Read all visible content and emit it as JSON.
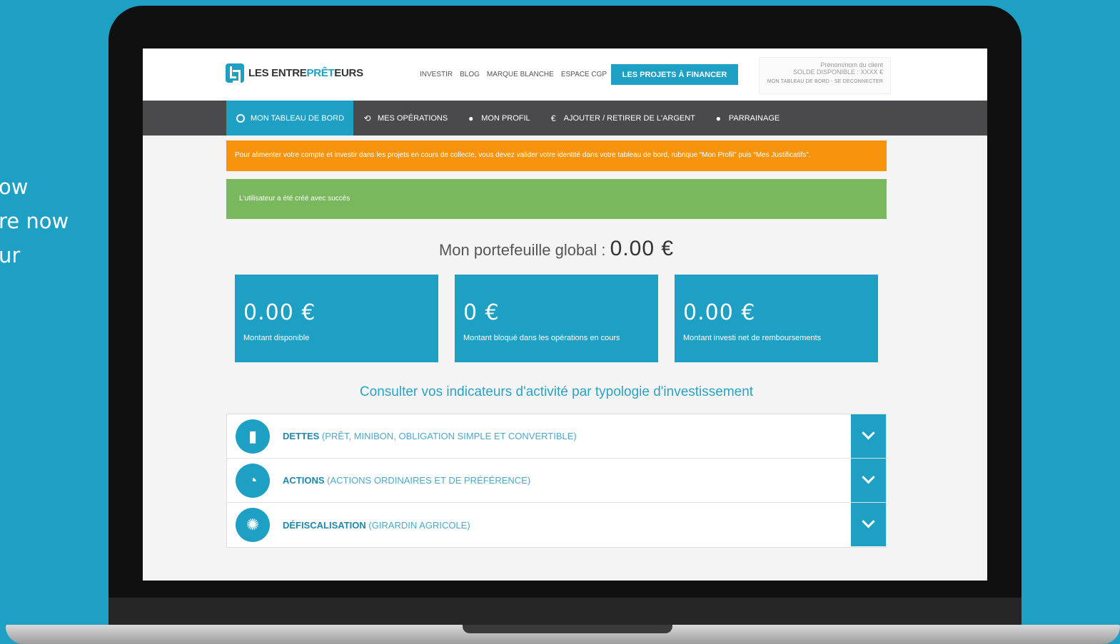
{
  "side_text": [
    "ow",
    "re now",
    "ur"
  ],
  "header": {
    "logo_prefix": "LES ENTRE",
    "logo_accent": "PRÊT",
    "logo_suffix": "EURS",
    "nav": [
      "INVESTIR",
      "BLOG",
      "MARQUE BLANCHE",
      "ESPACE CGP"
    ],
    "cta": "LES PROJETS À FINANCER",
    "client_name": "Prénom/nom du client",
    "client_balance": "SOLDE DISPONIBLE : XXXX €",
    "client_links": "MON TABLEAU DE BORD - SE DECONNECTER"
  },
  "navbar": {
    "items": [
      {
        "label": "MON TABLEAU DE BORD",
        "icon": "dashboard-icon",
        "active": true
      },
      {
        "label": "MES OPÉRATIONS",
        "icon": "history-icon"
      },
      {
        "label": "MON PROFIL",
        "icon": "user-icon"
      },
      {
        "label": "AJOUTER / RETIRER DE L'ARGENT",
        "icon": "euro-icon"
      },
      {
        "label": "PARRAINAGE",
        "icon": "user-plus-icon"
      }
    ]
  },
  "alerts": {
    "warning": "Pour alimenter votre compte et investir dans les projets en cours de collecte, vous devez valider votre identité dans votre tableau de bord, rubrique “Mon Profil” puis “Mes Justificatifs”.",
    "success": "L'utilisateur a été créé avec succès"
  },
  "portfolio": {
    "label": "Mon portefeuille global : ",
    "amount": "0.00 €"
  },
  "cards": [
    {
      "value": "0.00 €",
      "label": "Montant disponible"
    },
    {
      "value": "0 €",
      "label": "Montant bloqué dans les opérations en cours"
    },
    {
      "value": "0.00 €",
      "label": "Montant investi net de remboursements"
    }
  ],
  "indicators_title": "Consulter vos indicateurs d'activité par typologie d'investissement",
  "accordion": [
    {
      "main": "DETTES",
      "sub": " (PRÊT, MINIBON, OBLIGATION SIMPLE ET CONVERTIBLE)",
      "icon": "bar-chart-icon"
    },
    {
      "main": "ACTIONS",
      "sub": " (ACTIONS ORDINAIRES ET DE PRÉFÉRENCE)",
      "icon": "pie-chart-icon"
    },
    {
      "main": "DÉFISCALISATION",
      "sub": " (GIRARDIN AGRICOLE)",
      "icon": "tree-icon"
    }
  ],
  "colors": {
    "brand": "#1e9fc4",
    "warning": "#f8930d",
    "success": "#7ab85e",
    "navbar": "#4a4a4d"
  }
}
